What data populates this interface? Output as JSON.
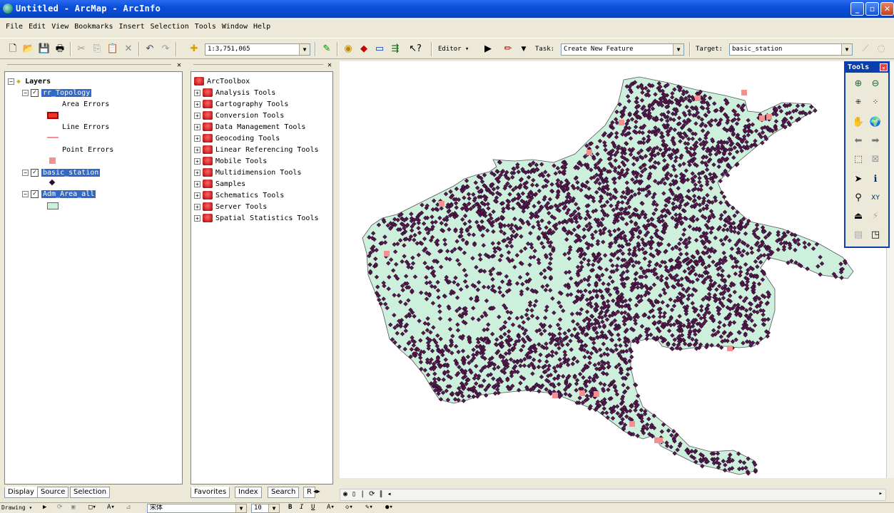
{
  "window": {
    "title": "Untitled - ArcMap - ArcInfo",
    "min": "_",
    "max": "▫",
    "close": "✕"
  },
  "menu": [
    "File",
    "Edit",
    "View",
    "Bookmarks",
    "Insert",
    "Selection",
    "Tools",
    "Window",
    "Help"
  ],
  "toolbar": {
    "scale": "1:3,751,065",
    "editor": "Editor ▾",
    "task_label": "Task:",
    "task_value": "Create New Feature",
    "target_label": "Target:",
    "target_value": "basic_station"
  },
  "toc": {
    "root": "Layers",
    "layers": [
      {
        "name": "rr_Topology",
        "items": [
          "Area Errors",
          "Line Errors",
          "Point Errors"
        ]
      },
      {
        "name": "basic_station"
      },
      {
        "name": "Adm_Area_all"
      }
    ],
    "tabs": [
      "Display",
      "Source",
      "Selection"
    ]
  },
  "toolbox": {
    "root": "ArcToolbox",
    "items": [
      "Analysis Tools",
      "Cartography Tools",
      "Conversion Tools",
      "Data Management Tools",
      "Geocoding Tools",
      "Linear Referencing Tools",
      "Mobile Tools",
      "Multidimension Tools",
      "Samples",
      "Schematics Tools",
      "Server Tools",
      "Spatial Statistics Tools"
    ],
    "tabs": [
      "Favorites",
      "Index",
      "Search",
      "R"
    ]
  },
  "tools_palette": {
    "title": "Tools"
  },
  "drawing": {
    "font": "宋体",
    "size": "10",
    "bold": "B",
    "italic": "I",
    "underline": "U",
    "drawing_label": "Drawing ▾"
  },
  "colors": {
    "region_fill": "#cdf0dd",
    "point_fill": "#5a1750",
    "error_fill": "#f49090",
    "selection": "#316ac5"
  }
}
